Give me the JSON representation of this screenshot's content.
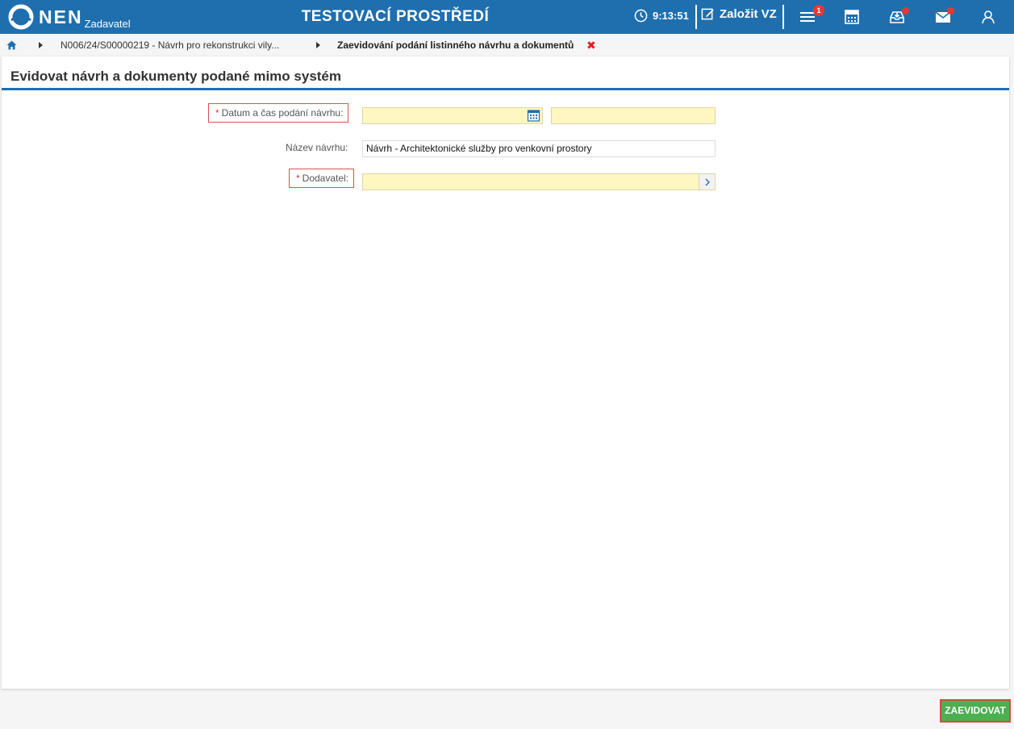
{
  "header": {
    "logo_text": "NEN",
    "role": "Zadavatel",
    "environment_title": "TESTOVACÍ PROSTŘEDÍ",
    "clock": "9:13:51",
    "create_vz_label": "Založit VZ",
    "menu_badge": "1",
    "colors": {
      "bar": "#1f6fae",
      "badge": "#e53935"
    }
  },
  "breadcrumb": {
    "item1": "N006/24/S00000219 - Návrh pro rekonstrukci vily...",
    "item2": "Zaevidování podání listinného návrhu a dokumentů",
    "close_symbol": "✖"
  },
  "panel": {
    "title": "Evidovat návrh a dokumenty podané mimo systém"
  },
  "form": {
    "date": {
      "label": "Datum a čas podání návrhu",
      "required": "*",
      "value": "",
      "time_value": ""
    },
    "name": {
      "label": "Název návrhu",
      "value": "Návrh - Architektonické služby pro venkovní prostory"
    },
    "supplier": {
      "label": "Dodavatel",
      "required": "*",
      "value": ""
    },
    "colon": ":"
  },
  "footer": {
    "submit_label": "ZAEVIDOVAT"
  }
}
